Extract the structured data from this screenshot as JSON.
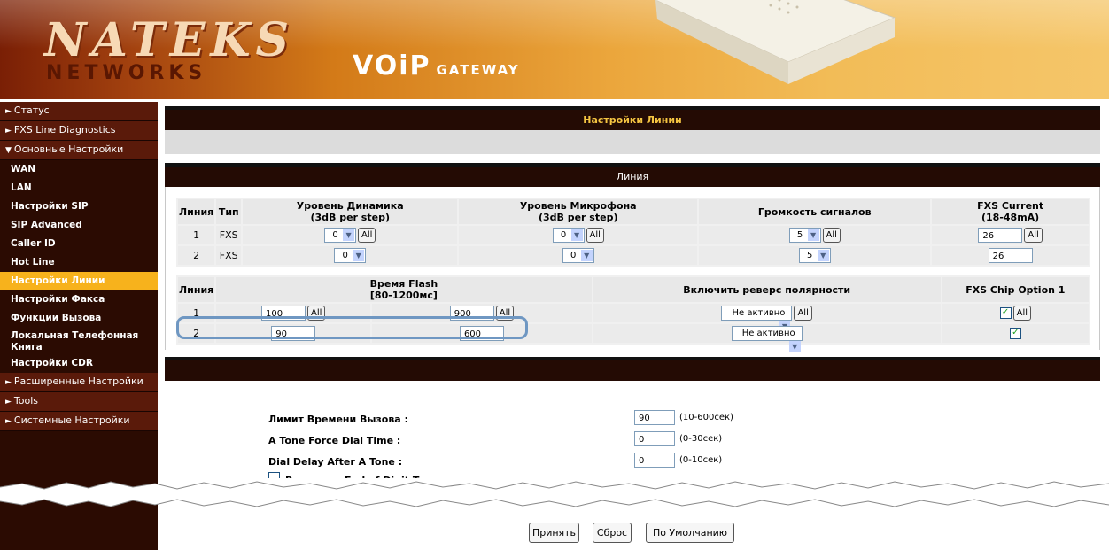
{
  "brand": {
    "logo_top": "NATEKS",
    "logo_bottom": "NETWORKS",
    "product_main": "VOiP",
    "product_sub": "GATEWAY"
  },
  "sidebar": {
    "items": [
      {
        "label": "Статус",
        "arrow": "►"
      },
      {
        "label": "FXS Line Diagnostics",
        "arrow": "►"
      },
      {
        "label": "Основные Настройки",
        "arrow": "▼"
      }
    ],
    "sub_items": [
      {
        "label": "WAN"
      },
      {
        "label": "LAN"
      },
      {
        "label": "Настройки SIP"
      },
      {
        "label": "SIP Advanced"
      },
      {
        "label": "Caller ID"
      },
      {
        "label": "Hot Line"
      },
      {
        "label": "Настройки Линии"
      },
      {
        "label": "Настройки Факса"
      },
      {
        "label": "Функции Вызова"
      },
      {
        "label": "Локальная Телефонная Книга"
      },
      {
        "label": "Настройки CDR"
      }
    ],
    "bottom_items": [
      {
        "label": "Расширенные Настройки",
        "arrow": "►"
      },
      {
        "label": "Tools",
        "arrow": "►"
      },
      {
        "label": "Системные Настройки",
        "arrow": "►"
      }
    ]
  },
  "page_title": "Настройки Линии",
  "line_section": {
    "title": "Линия",
    "table1": {
      "headers": [
        "Линия",
        "Тип",
        "Уровень Динамика\n(3dB per step)",
        "Уровень Микрофона\n(3dB per step)",
        "Громкость сигналов",
        "FXS Current\n(18-48mA)"
      ],
      "rows": [
        {
          "line": "1",
          "type": "FXS",
          "speaker": "0",
          "mic": "0",
          "volume": "5",
          "current": "26"
        },
        {
          "line": "2",
          "type": "FXS",
          "speaker": "0",
          "mic": "0",
          "volume": "5",
          "current": "26"
        }
      ]
    },
    "table2": {
      "headers": [
        "Линия",
        "Время Flash\n[80-1200мс]",
        "Включить реверс полярности",
        "FXS Chip Option 1"
      ],
      "rows": [
        {
          "line": "1",
          "flash_min": "100",
          "flash_max": "900",
          "polarity": "Не активно",
          "chip": "✓"
        },
        {
          "line": "2",
          "flash_min": "90",
          "flash_max": "600",
          "polarity": "Не активно",
          "chip": "✓"
        }
      ]
    },
    "all_label": "All"
  },
  "call_settings": {
    "fields": [
      {
        "label": "Лимит Времени Вызова :",
        "value": "90",
        "hint": "(10-600сек)"
      },
      {
        "label": "A Tone Force Dial Time :",
        "value": "0",
        "hint": "(0-30сек)"
      },
      {
        "label": "Dial Delay After A Tone :",
        "value": "0",
        "hint": "(0-10сек)"
      }
    ],
    "checkbox_label": "Включить End of Digit Tone"
  },
  "actions": {
    "apply": "Принять",
    "reset": "Сброс",
    "defaults": "По Умолчанию"
  },
  "colors": {
    "accent": "#f7b21c",
    "header_dark": "#240b04",
    "title_gold": "#f5c542"
  }
}
